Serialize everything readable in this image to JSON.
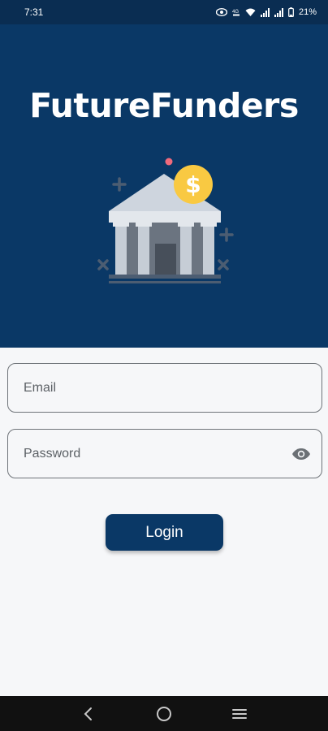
{
  "status_bar": {
    "time": "7:31",
    "battery": "21%",
    "icons": [
      "eye-icon",
      "volte-icon",
      "wifi-icon",
      "signal-icon",
      "signal-icon",
      "battery-icon"
    ]
  },
  "app": {
    "title": "FutureFunders",
    "illustration": "bank-icon",
    "colors": {
      "primary": "#0a3866",
      "status_bar": "#0a2d52",
      "coin": "#f9c942",
      "background": "#f6f7f9"
    }
  },
  "form": {
    "email_placeholder": "Email",
    "password_placeholder": "Password",
    "password_toggle_icon": "eye-icon",
    "login_label": "Login"
  },
  "nav_bar": {
    "icons": [
      "back-icon",
      "home-icon",
      "menu-icon"
    ]
  }
}
